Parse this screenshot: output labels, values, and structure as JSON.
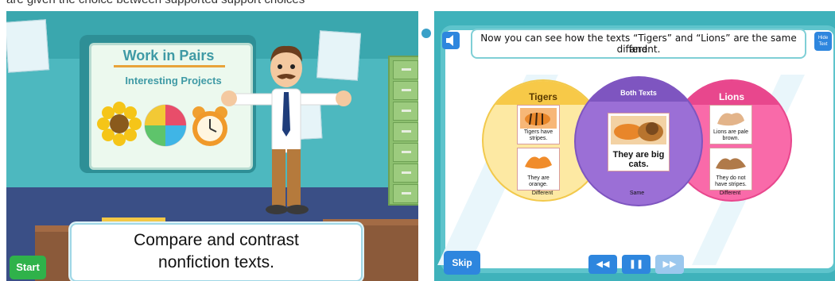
{
  "top_caption": "are given the choice between supported support choices",
  "left_slide": {
    "board_title": "Work in Pairs",
    "board_subtitle": "Interesting Projects",
    "caption_line1": "Compare and contrast",
    "caption_line2": "nonfiction texts.",
    "start_label": "Start"
  },
  "right_slide": {
    "instruction_line1": "Now you can see how the texts “Tigers” and “Lions” are the same and",
    "instruction_line2": "different.",
    "hide_text_label": "Hide Text",
    "tigers": {
      "heading": "Tigers",
      "card1": "Tigers have stripes.",
      "card2": "They are orange.",
      "footer": "Different"
    },
    "both": {
      "heading": "Both Texts",
      "card": "They are big cats.",
      "footer": "Same"
    },
    "lions": {
      "heading": "Lions",
      "card1": "Lions are pale brown.",
      "card2": "They do not have stripes.",
      "footer": "Different"
    },
    "skip_label": "Skip",
    "rewind_glyph": "◀◀",
    "pause_glyph": "❚❚",
    "forward_glyph": "▶▶"
  },
  "colors": {
    "tigers": "#fde9a3",
    "tigers_head": "#f7c948",
    "both": "#9b6fd6",
    "both_head": "#7e55c0",
    "lions": "#f96aa9",
    "lions_head": "#e8478d",
    "accent_blue": "#2e86de",
    "start_green": "#2fb24a"
  }
}
